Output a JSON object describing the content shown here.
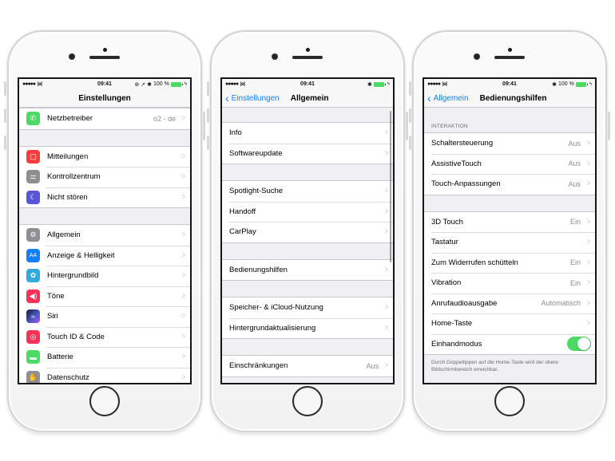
{
  "status_bar": {
    "time": "09:41",
    "signal": "●●●●●",
    "battery_label": "100 %"
  },
  "phone1": {
    "nav_title": "Einstellungen",
    "groups": [
      [
        {
          "label": "Netzbetreiber",
          "value": "o2 - de",
          "icon": "phone-icon",
          "color": "#4cd964",
          "glyph": "✆"
        }
      ],
      [
        {
          "label": "Mitteilungen",
          "value": "",
          "icon": "notifications-icon",
          "color": "#fc3d39",
          "glyph": "▢"
        },
        {
          "label": "Kontrollzentrum",
          "value": "",
          "icon": "control-center-icon",
          "color": "#8e8e93",
          "glyph": "⚌"
        },
        {
          "label": "Nicht stören",
          "value": "",
          "icon": "moon-icon",
          "color": "#5856d6",
          "glyph": "☾"
        }
      ],
      [
        {
          "label": "Allgemein",
          "value": "",
          "icon": "gear-icon",
          "color": "#8e8e93",
          "glyph": "⚙"
        },
        {
          "label": "Anzeige & Helligkeit",
          "value": "",
          "icon": "display-icon",
          "color": "#147efb",
          "glyph": "AA"
        },
        {
          "label": "Hintergrundbild",
          "value": "",
          "icon": "wallpaper-icon",
          "color": "#34aadc",
          "glyph": "✿"
        },
        {
          "label": "Töne",
          "value": "",
          "icon": "sound-icon",
          "color": "#fc3158",
          "glyph": "◀)"
        },
        {
          "label": "Siri",
          "value": "",
          "icon": "siri-icon",
          "color": "#3a3a8c",
          "glyph": "≈"
        },
        {
          "label": "Touch ID & Code",
          "value": "",
          "icon": "fingerprint-icon",
          "color": "#fc3158",
          "glyph": "◎"
        },
        {
          "label": "Batterie",
          "value": "",
          "icon": "battery-icon",
          "color": "#4cd964",
          "glyph": "▬"
        },
        {
          "label": "Datenschutz",
          "value": "",
          "icon": "hand-icon",
          "color": "#8e8e93",
          "glyph": "✋"
        }
      ]
    ]
  },
  "phone2": {
    "back_label": "Einstellungen",
    "nav_title": "Allgemein",
    "groups": [
      [
        {
          "label": "Info",
          "value": ""
        },
        {
          "label": "Softwareupdate",
          "value": ""
        }
      ],
      [
        {
          "label": "Spotlight-Suche",
          "value": ""
        },
        {
          "label": "Handoff",
          "value": ""
        },
        {
          "label": "CarPlay",
          "value": ""
        }
      ],
      [
        {
          "label": "Bedienungshilfen",
          "value": ""
        }
      ],
      [
        {
          "label": "Speicher- & iCloud-Nutzung",
          "value": ""
        },
        {
          "label": "Hintergrundaktualisierung",
          "value": ""
        }
      ],
      [
        {
          "label": "Einschränkungen",
          "value": "Aus"
        }
      ]
    ]
  },
  "phone3": {
    "back_label": "Allgemein",
    "nav_title": "Bedienungshilfen",
    "section_header": "INTERAKTION",
    "groups": [
      [
        {
          "label": "Schaltersteuerung",
          "value": "Aus"
        },
        {
          "label": "AssistiveTouch",
          "value": "Aus"
        },
        {
          "label": "Touch-Anpassungen",
          "value": "Aus"
        }
      ],
      [
        {
          "label": "3D Touch",
          "value": "Ein"
        },
        {
          "label": "Tastatur",
          "value": ""
        },
        {
          "label": "Zum Widerrufen schütteln",
          "value": "Ein"
        },
        {
          "label": "Vibration",
          "value": "Ein"
        },
        {
          "label": "Anrufaudioausgabe",
          "value": "Automatisch"
        },
        {
          "label": "Home-Taste",
          "value": ""
        }
      ]
    ],
    "toggle_row": {
      "label": "Einhandmodus",
      "on": true
    },
    "footer_note": "Durch Doppeltippen auf die Home-Taste wird der obere Bildschirmbereich erreichbar."
  },
  "colors": {
    "tint": "#147efb",
    "toggle_on": "#4cd964",
    "group_bg": "#efeff4"
  }
}
